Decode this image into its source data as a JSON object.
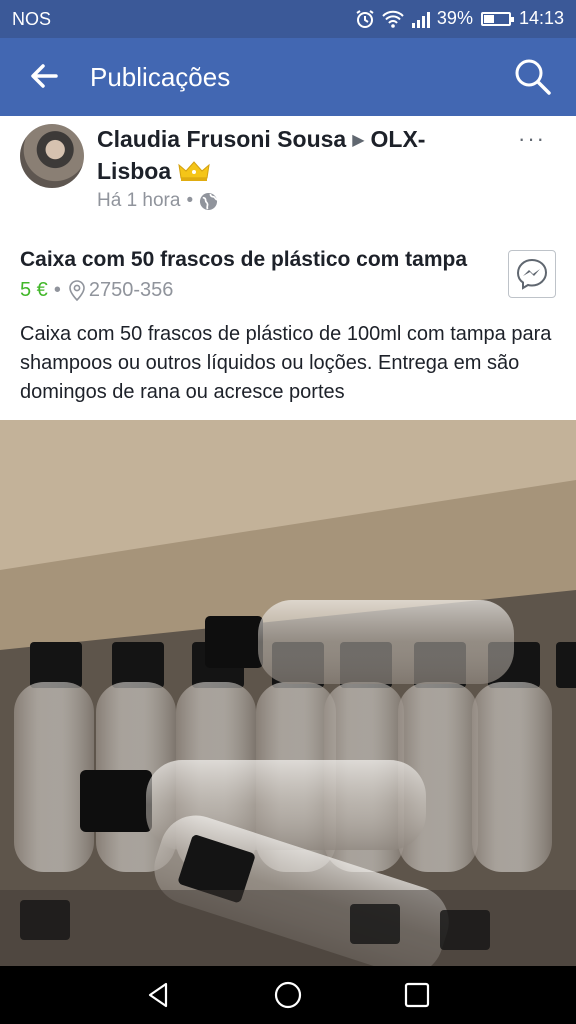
{
  "status": {
    "carrier": "NOS",
    "battery": "39%",
    "time": "14:13"
  },
  "appbar": {
    "title": "Publicações"
  },
  "post": {
    "author": "Claudia Frusoni Sousa",
    "group": "OLX-Lisboa",
    "time": "Há 1 hora",
    "separator": "•",
    "more": "···",
    "listing": {
      "title": "Caixa com 50 frascos de plástico com tampa",
      "price": "5 €",
      "location": "2750-356",
      "description": "Caixa com 50 frascos de plástico de 100ml com tampa para shampoos ou outros líquidos ou loções. Entrega em são domingos de rana ou acresce portes"
    }
  },
  "icons": [
    "back-arrow-icon",
    "search-icon",
    "more-icon",
    "crown-icon",
    "globe-icon",
    "location-pin-icon",
    "messenger-icon",
    "alarm-icon",
    "wifi-icon",
    "signal-icon",
    "battery-icon",
    "nav-back-icon",
    "nav-home-icon",
    "nav-recents-icon"
  ],
  "colors": {
    "brand": "#4267b2",
    "statusbar": "#3b5998",
    "price": "#42b72a"
  }
}
